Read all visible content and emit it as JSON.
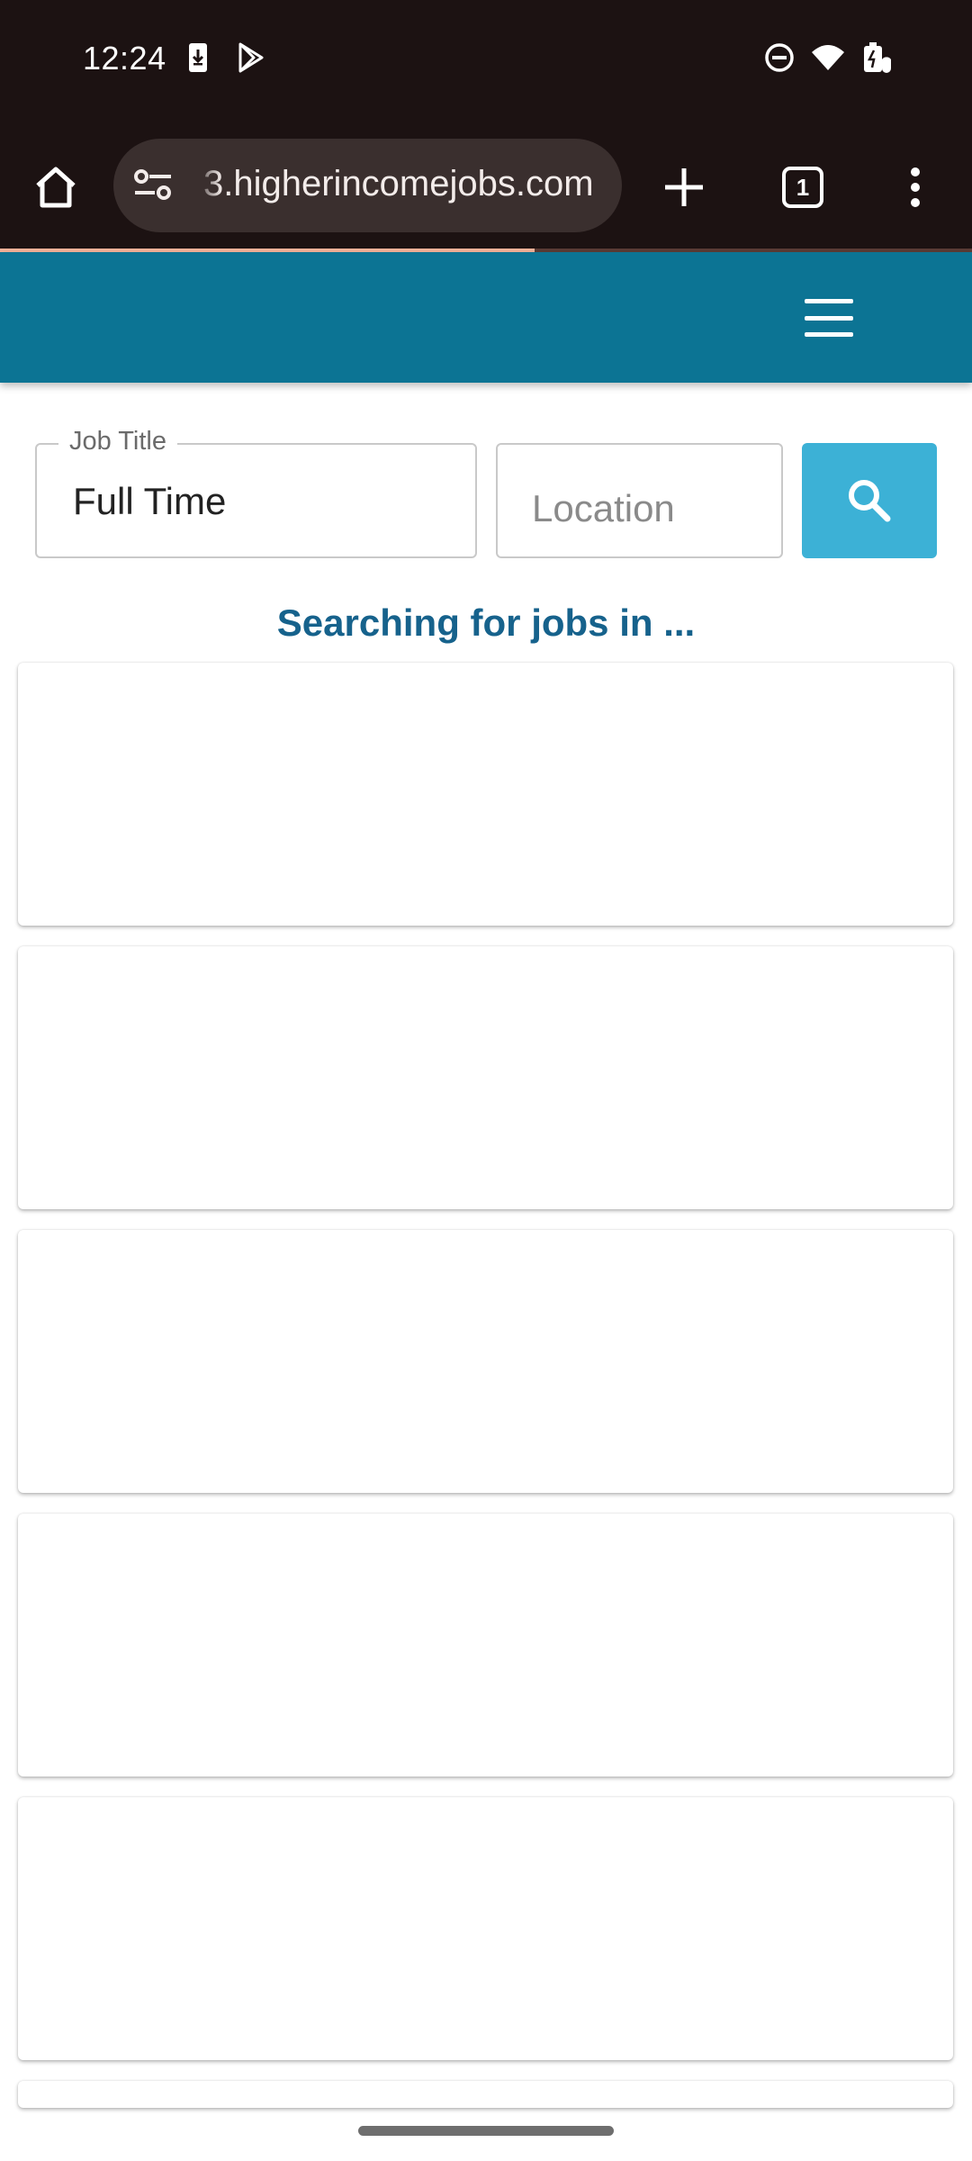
{
  "status_bar": {
    "time": "12:24",
    "icons": [
      "download-phone-icon",
      "play-store-icon",
      "do-not-disturb-icon",
      "wifi-icon",
      "battery-icon"
    ]
  },
  "browser": {
    "url": "3.higherincomejobs.com",
    "tab_count": "1",
    "page_load_progress": 0.55
  },
  "search": {
    "job_title_label": "Job Title",
    "job_title_value": "Full Time",
    "location_placeholder": "Location",
    "location_value": "",
    "status_text": "Searching for jobs in ..."
  },
  "colors": {
    "browser_chrome": "#1c1212",
    "header": "#0c7494",
    "search_button": "#3cb1d6",
    "status_text": "#16628c"
  }
}
